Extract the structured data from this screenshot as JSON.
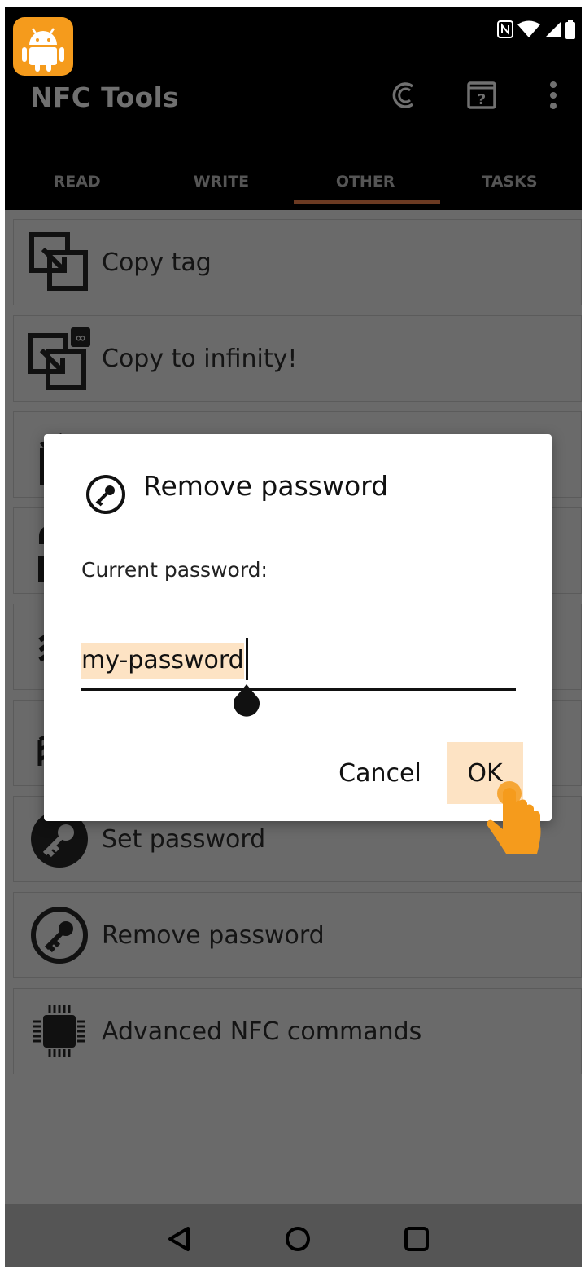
{
  "app": {
    "title": "NFC Tools"
  },
  "toolbar": {
    "icons": [
      "coin-icon",
      "help-icon",
      "more-vert-icon"
    ]
  },
  "tabs": [
    {
      "label": "READ",
      "active": false
    },
    {
      "label": "WRITE",
      "active": false
    },
    {
      "label": "OTHER",
      "active": true
    },
    {
      "label": "TASKS",
      "active": false
    }
  ],
  "list": {
    "items": [
      {
        "label": "Copy tag",
        "icon": "copy-tag-icon"
      },
      {
        "label": "Copy to infinity!",
        "icon": "copy-infinity-icon"
      },
      {
        "label": "",
        "icon": "erase-icon"
      },
      {
        "label": "",
        "icon": "lock-icon"
      },
      {
        "label": "",
        "icon": "format-icon"
      },
      {
        "label": "",
        "icon": "memory-icon"
      },
      {
        "label": "Set password",
        "icon": "key-filled-icon"
      },
      {
        "label": "Remove password",
        "icon": "key-outline-icon"
      },
      {
        "label": "Advanced NFC commands",
        "icon": "chip-icon"
      }
    ]
  },
  "dialog": {
    "title": "Remove password",
    "title_icon": "key-circle-icon",
    "prompt": "Current password:",
    "password_value": "my-password",
    "cancel_label": "Cancel",
    "ok_label": "OK"
  },
  "navigation": {
    "icons": [
      "back-icon",
      "home-icon",
      "recents-icon"
    ]
  },
  "colors": {
    "app_bar": "#000000",
    "scrim": "#6a6a6a",
    "tab_indicator": "#6b3a22",
    "selection_highlight": "#fde3c4",
    "badge_orange": "#f59b1c"
  }
}
